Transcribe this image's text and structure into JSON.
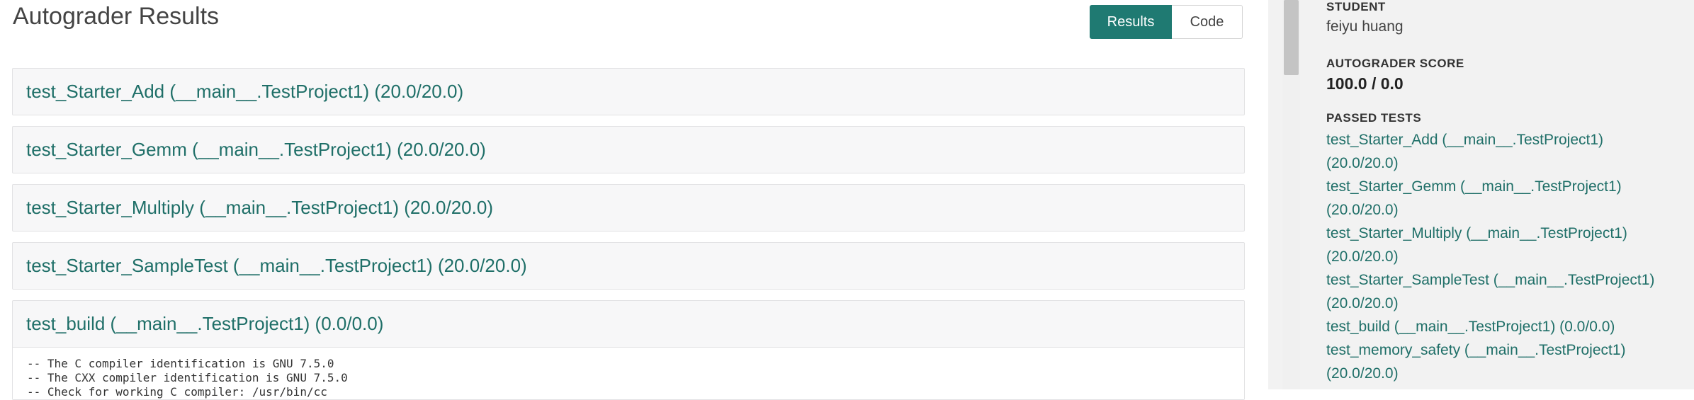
{
  "header": {
    "title": "Autograder Results",
    "results_label": "Results",
    "code_label": "Code"
  },
  "tests": [
    {
      "title": "test_Starter_Add (__main__.TestProject1) (20.0/20.0)"
    },
    {
      "title": "test_Starter_Gemm (__main__.TestProject1) (20.0/20.0)"
    },
    {
      "title": "test_Starter_Multiply (__main__.TestProject1) (20.0/20.0)"
    },
    {
      "title": "test_Starter_SampleTest (__main__.TestProject1) (20.0/20.0)"
    },
    {
      "title": "test_build (__main__.TestProject1) (0.0/0.0)"
    }
  ],
  "build_output": [
    "-- The C compiler identification is GNU 7.5.0",
    "-- The CXX compiler identification is GNU 7.5.0",
    "-- Check for working C compiler: /usr/bin/cc"
  ],
  "sidebar": {
    "student_label": "STUDENT",
    "student_name": "feiyu huang",
    "score_label": "AUTOGRADER SCORE",
    "score_value": "100.0 / 0.0",
    "passed_label": "PASSED TESTS",
    "passed_tests": [
      [
        "test_Starter_Add (__main__.TestProject1)",
        "(20.0/20.0)"
      ],
      [
        "test_Starter_Gemm (__main__.TestProject1)",
        "(20.0/20.0)"
      ],
      [
        "test_Starter_Multiply (__main__.TestProject1)",
        "(20.0/20.0)"
      ],
      [
        "test_Starter_SampleTest (__main__.TestProject1)",
        "(20.0/20.0)"
      ],
      [
        "test_build (__main__.TestProject1) (0.0/0.0)"
      ],
      [
        "test_memory_safety (__main__.TestProject1)",
        "(20.0/20.0)"
      ]
    ]
  },
  "colors": {
    "accent": "#1f7a72",
    "link": "#1f6f68",
    "sidebar_bg": "#f2f2f2"
  }
}
